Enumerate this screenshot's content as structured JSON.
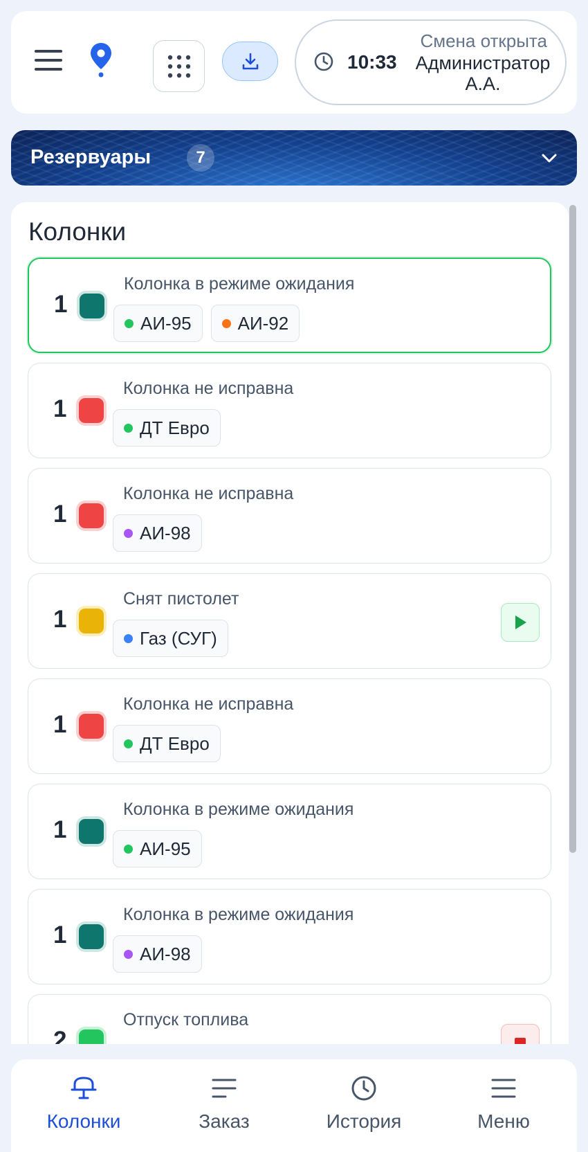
{
  "header": {
    "menu_icon": "hamburger-icon",
    "location_icon": "map-pin-icon",
    "apps_icon": "grid-dots-icon",
    "download_icon": "download-icon",
    "shift": {
      "time": "10:33",
      "status": "Смена открыта",
      "user": "Администратор А.А."
    }
  },
  "tanks": {
    "title": "Резервуары",
    "count": "7"
  },
  "main": {
    "title": "Колонки",
    "pumps": [
      {
        "number": "1",
        "status": "Колонка в режиме ожидания",
        "color": "teal",
        "active": true,
        "fuels": [
          {
            "name": "АИ-95",
            "dot": "#22c55e"
          },
          {
            "name": "АИ-92",
            "dot": "#f97316"
          }
        ]
      },
      {
        "number": "1",
        "status": "Колонка не исправна",
        "color": "red",
        "fuels": [
          {
            "name": "ДТ Евро",
            "dot": "#22c55e"
          }
        ]
      },
      {
        "number": "1",
        "status": "Колонка не исправна",
        "color": "red",
        "fuels": [
          {
            "name": "АИ-98",
            "dot": "#a855f7"
          }
        ]
      },
      {
        "number": "1",
        "status": "Снят пистолет",
        "color": "yellow",
        "action": "play",
        "fuels": [
          {
            "name": "Газ (СУГ)",
            "dot": "#3b82f6"
          }
        ]
      },
      {
        "number": "1",
        "status": "Колонка не исправна",
        "color": "red",
        "fuels": [
          {
            "name": "ДТ Евро",
            "dot": "#22c55e"
          }
        ]
      },
      {
        "number": "1",
        "status": "Колонка в режиме ожидания",
        "color": "teal",
        "fuels": [
          {
            "name": "АИ-95",
            "dot": "#22c55e"
          }
        ]
      },
      {
        "number": "1",
        "status": "Колонка в режиме ожидания",
        "color": "teal",
        "fuels": [
          {
            "name": "АИ-98",
            "dot": "#a855f7"
          }
        ]
      },
      {
        "number": "2",
        "status": "Отпуск топлива",
        "color": "green",
        "action": "stop",
        "fuels": []
      }
    ]
  },
  "nav": {
    "items": [
      {
        "label": "Колонки",
        "icon": "pump-icon",
        "active": true
      },
      {
        "label": "Заказ",
        "icon": "order-lines-icon"
      },
      {
        "label": "История",
        "icon": "clock-icon"
      },
      {
        "label": "Меню",
        "icon": "menu-icon"
      }
    ]
  },
  "colors": {
    "accent": "#1d4ed8",
    "active_border": "#22c55e",
    "status_teal": "#0f766e",
    "status_red": "#ef4444",
    "status_yellow": "#eab308",
    "status_green": "#22c55e"
  }
}
